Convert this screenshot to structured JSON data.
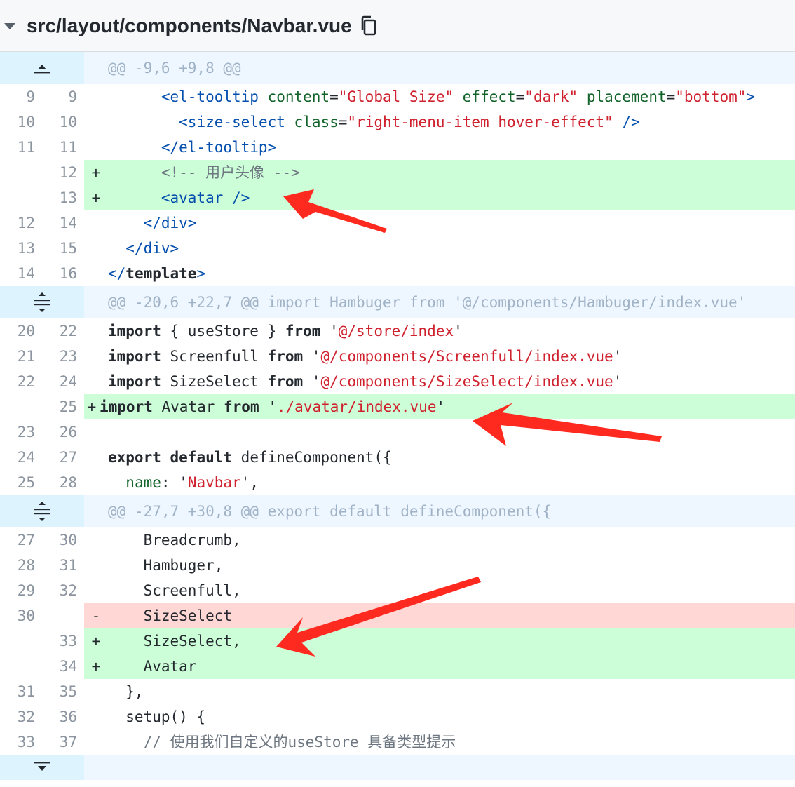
{
  "file": {
    "path": "src/layout/components/Navbar.vue"
  },
  "hunks": [
    "@@ -9,6 +9,8 @@",
    "@@ -20,6 +22,7 @@ import Hambuger from '@/components/Hambuger/index.vue'",
    "@@ -27,7 +30,8 @@ export default defineComponent({"
  ],
  "lines": [
    {
      "old": "9",
      "new": "9"
    },
    {
      "old": "10",
      "new": "10"
    },
    {
      "old": "11",
      "new": "11"
    },
    {
      "old": "",
      "new": "12",
      "prefix": "+"
    },
    {
      "old": "",
      "new": "13",
      "prefix": "+"
    },
    {
      "old": "12",
      "new": "14"
    },
    {
      "old": "13",
      "new": "15"
    },
    {
      "old": "14",
      "new": "16"
    },
    {
      "old": "20",
      "new": "22"
    },
    {
      "old": "21",
      "new": "23"
    },
    {
      "old": "22",
      "new": "24"
    },
    {
      "old": "",
      "new": "25",
      "prefix": "+"
    },
    {
      "old": "23",
      "new": "26"
    },
    {
      "old": "24",
      "new": "27"
    },
    {
      "old": "25",
      "new": "28"
    },
    {
      "old": "27",
      "new": "30"
    },
    {
      "old": "28",
      "new": "31"
    },
    {
      "old": "29",
      "new": "32"
    },
    {
      "old": "30",
      "new": "",
      "prefix": "-"
    },
    {
      "old": "",
      "new": "33",
      "prefix": "+"
    },
    {
      "old": "",
      "new": "34",
      "prefix": "+"
    },
    {
      "old": "31",
      "new": "35"
    },
    {
      "old": "32",
      "new": "36"
    },
    {
      "old": "33",
      "new": "37"
    }
  ],
  "tokens": {
    "l1": [
      "      ",
      "<el-tooltip ",
      "content",
      "=",
      "\"Global Size\"",
      " ",
      "effect",
      "=",
      "\"dark\"",
      " ",
      "placement",
      "=",
      "\"bottom\"",
      ">"
    ],
    "l2": [
      "        ",
      "<size-select ",
      "class",
      "=",
      "\"right-menu-item hover-effect\"",
      " />"
    ],
    "l3": [
      "      ",
      "</el-tooltip>"
    ],
    "l4": [
      "      ",
      "<!-- 用户头像 -->"
    ],
    "l5": [
      "      ",
      "<avatar />"
    ],
    "l6": [
      "    ",
      "</div>"
    ],
    "l7": [
      "  ",
      "</div>"
    ],
    "l8": [
      "</",
      "template",
      ">"
    ],
    "l9": [
      "import",
      " { useStore } ",
      "from",
      " '",
      "@/store/index",
      "'"
    ],
    "l10": [
      "import",
      " Screenfull ",
      "from",
      " '",
      "@/components/Screenfull/index.vue",
      "'"
    ],
    "l11": [
      "import",
      " SizeSelect ",
      "from",
      " '",
      "@/components/SizeSelect/index.vue",
      "'"
    ],
    "l12": [
      "import",
      " Avatar ",
      "from",
      " '",
      "./avatar/index.vue",
      "'"
    ],
    "l14": [
      "export",
      " ",
      "default",
      " defineComponent({"
    ],
    "l15": [
      "  ",
      "name",
      ": '",
      "Navbar",
      "',"
    ],
    "l16": "    Breadcrumb,",
    "l17": "    Hambuger,",
    "l18": "    Screenfull,",
    "l19": "    SizeSelect",
    "l20": "    SizeSelect,",
    "l21": "    Avatar",
    "l22": "  },",
    "l23": "  setup() {",
    "l24": "    // 使用我们自定义的useStore 具备类型提示"
  },
  "colors": {
    "added_bg": "#ccffd8",
    "removed_bg": "#ffd7d5",
    "hunk_bg": "#ddf4ff",
    "arrow": "#ff2a1f"
  }
}
